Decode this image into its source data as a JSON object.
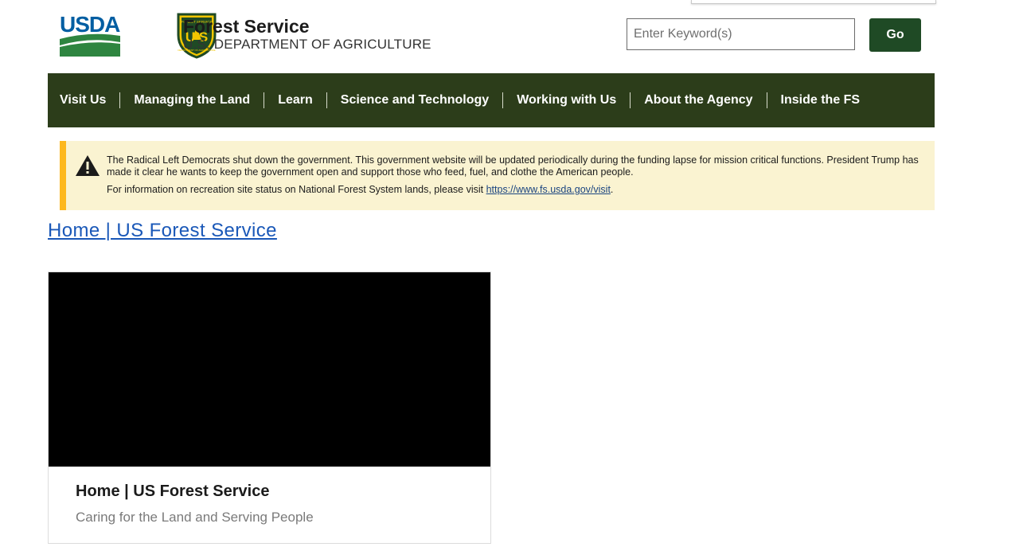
{
  "header": {
    "usda_logo_text": "USDA",
    "agency_name": "Forest Service",
    "department": "U.S. DEPARTMENT OF AGRICULTURE",
    "shield_text": "FOREST SERVICE",
    "shield_letters": "U S",
    "shield_bottom": "DEPARTMENT OF AGRICULTURE"
  },
  "search": {
    "placeholder": "Enter Keyword(s)",
    "button_label": "Go"
  },
  "nav": {
    "items": [
      {
        "label": "Visit Us"
      },
      {
        "label": "Managing the Land"
      },
      {
        "label": "Learn"
      },
      {
        "label": "Science and Technology"
      },
      {
        "label": "Working with Us"
      },
      {
        "label": "About the Agency"
      },
      {
        "label": "Inside the FS"
      }
    ]
  },
  "alert": {
    "message": "The Radical Left Democrats shut down the government. This government website will be updated periodically during the funding lapse for mission critical functions. President Trump has made it clear he wants to keep the government open and support those who feed, fuel, and clothe the American people.",
    "info_prefix": "For information on recreation site status on National Forest System lands, please visit ",
    "info_link": "https://www.fs.usda.gov/visit",
    "info_suffix": "."
  },
  "page_link": "Home | US Forest Service",
  "card": {
    "title": "Home | US Forest Service",
    "subtitle": "Caring for the Land and Serving People"
  },
  "colors": {
    "nav_background": "#2c3d1a",
    "go_button": "#1f4a25",
    "alert_background": "#faf3d1",
    "alert_border": "#fdb81e",
    "link": "#1a58b8"
  },
  "icons": {
    "usda_logo": "usda-logo",
    "shield": "forest-service-shield-icon",
    "alert": "warning-triangle-icon"
  }
}
